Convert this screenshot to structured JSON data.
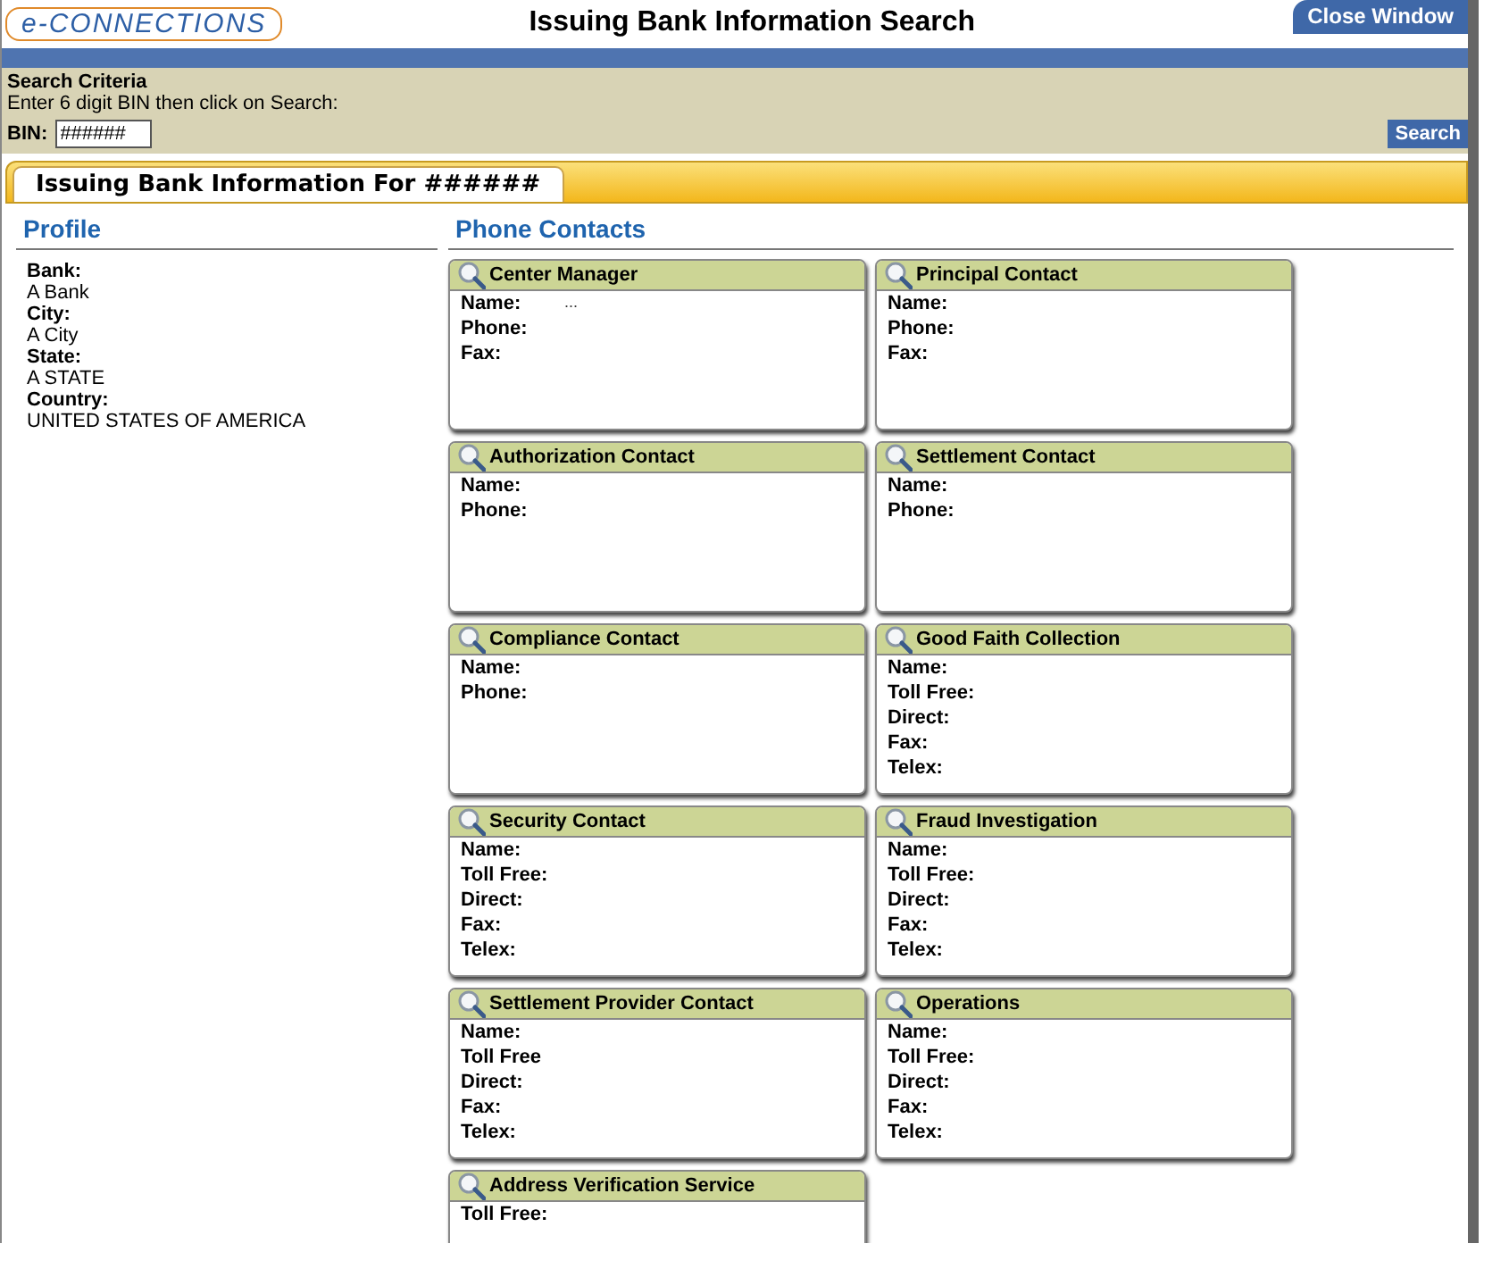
{
  "header": {
    "logo": "e-CONNECTIONS",
    "title": "Issuing Bank Information Search",
    "close_button": "Close Window"
  },
  "search": {
    "heading": "Search Criteria",
    "instruction": "Enter 6 digit BIN then click on Search:",
    "bin_label": "BIN:",
    "bin_value": "######",
    "button": "Search"
  },
  "tab": {
    "label": "Issuing Bank Information For ######"
  },
  "profile": {
    "heading": "Profile",
    "fields": [
      {
        "label": "Bank:",
        "value": "A Bank"
      },
      {
        "label": "City:",
        "value": "A City"
      },
      {
        "label": "State:",
        "value": "A STATE"
      },
      {
        "label": "Country:",
        "value": "UNITED STATES OF AMERICA"
      }
    ]
  },
  "contacts": {
    "heading": "Phone Contacts",
    "cards": [
      {
        "title": "Center Manager",
        "fields": [
          {
            "label": "Name:",
            "value": "..."
          },
          {
            "label": "Phone:"
          },
          {
            "label": "Fax:"
          }
        ]
      },
      {
        "title": "Principal Contact",
        "fields": [
          {
            "label": "Name:"
          },
          {
            "label": "Phone:"
          },
          {
            "label": "Fax:"
          }
        ]
      },
      {
        "title": "Authorization Contact",
        "fields": [
          {
            "label": "Name:"
          },
          {
            "label": "Phone:"
          }
        ]
      },
      {
        "title": "Settlement Contact",
        "fields": [
          {
            "label": "Name:"
          },
          {
            "label": "Phone:"
          }
        ]
      },
      {
        "title": "Compliance Contact",
        "fields": [
          {
            "label": "Name:"
          },
          {
            "label": "Phone:"
          }
        ]
      },
      {
        "title": "Good Faith Collection",
        "fields": [
          {
            "label": "Name:"
          },
          {
            "label": "Toll Free:"
          },
          {
            "label": "Direct:"
          },
          {
            "label": "Fax:"
          },
          {
            "label": "Telex:"
          }
        ]
      },
      {
        "title": "Security Contact",
        "fields": [
          {
            "label": "Name:"
          },
          {
            "label": "Toll Free:"
          },
          {
            "label": "Direct:"
          },
          {
            "label": "Fax:"
          },
          {
            "label": "Telex:"
          }
        ]
      },
      {
        "title": "Fraud Investigation",
        "fields": [
          {
            "label": "Name:"
          },
          {
            "label": "Toll Free:"
          },
          {
            "label": "Direct:"
          },
          {
            "label": "Fax:"
          },
          {
            "label": "Telex:"
          }
        ]
      },
      {
        "title": "Settlement Provider Contact",
        "fields": [
          {
            "label": "Name:"
          },
          {
            "label": "Toll Free"
          },
          {
            "label": "Direct:"
          },
          {
            "label": "Fax:"
          },
          {
            "label": "Telex:"
          }
        ]
      },
      {
        "title": "Operations",
        "fields": [
          {
            "label": "Name:"
          },
          {
            "label": "Toll Free:"
          },
          {
            "label": "Direct:"
          },
          {
            "label": "Fax:"
          },
          {
            "label": "Telex:"
          }
        ]
      },
      {
        "title": "Address Verification Service",
        "fields": [
          {
            "label": "Toll Free:"
          }
        ]
      }
    ]
  }
}
